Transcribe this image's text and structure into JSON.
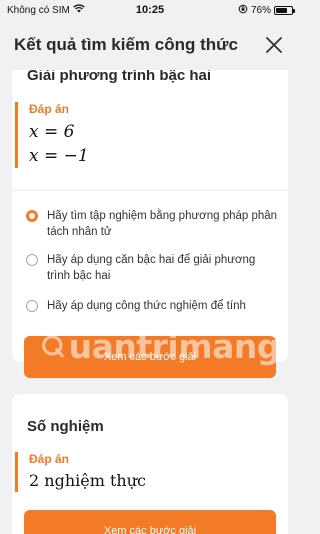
{
  "status_bar": {
    "carrier": "Không có SIM",
    "time": "10:25",
    "battery_text": "76%",
    "battery_level": 0.76
  },
  "header": {
    "title": "Kết quả tìm kiếm công thức"
  },
  "card1": {
    "title": "Giải phương trình bậc hai",
    "answer_label": "Đáp án",
    "answers": [
      "x = 6",
      "x = −1"
    ],
    "options": [
      {
        "text": "Hãy tìm tập nghiệm bằng phương pháp phân tách nhân tử",
        "selected": true
      },
      {
        "text": "Hãy áp dụng căn bậc hai để giải phương trình bậc hai",
        "selected": false
      },
      {
        "text": "Hãy áp dụng công thức nghiệm để tính",
        "selected": false
      }
    ],
    "button_label": "Xem các bước giải"
  },
  "card2": {
    "title": "Số nghiệm",
    "answer_label": "Đáp án",
    "answer": "2 nghiệm thực",
    "button_label": "Xem các bước giải"
  },
  "watermark": {
    "text": "uantrimang"
  },
  "colors": {
    "accent": "#f37a27",
    "background": "#f1f1f3"
  }
}
